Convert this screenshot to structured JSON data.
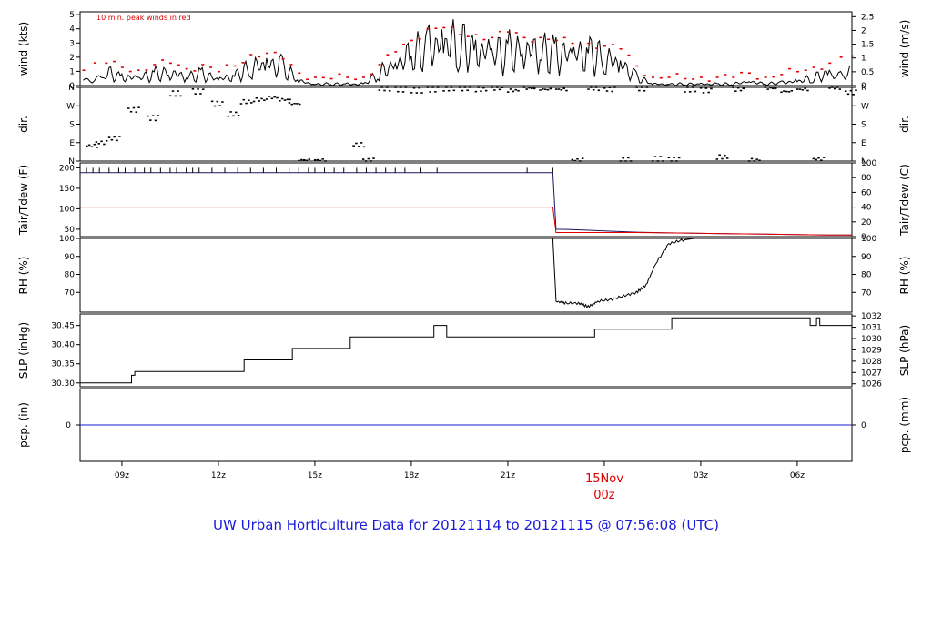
{
  "title": "UW Urban Horticulture Data for 20121114  to  20121115 @ 07:56:08  (UTC)",
  "colors": {
    "primary": "#000000",
    "peak": "#e00000",
    "dew": "#e00000",
    "precip": "#1a1adb",
    "title": "#1a1adb",
    "date": "#e00000"
  },
  "chart_data": [
    {
      "type": "line",
      "panel": "wind",
      "ylabel_left": "wind (kts)",
      "ylabel_right": "wind (m/s)",
      "annotation": "10 min. peak winds in red",
      "ylim": [
        0,
        5.2
      ],
      "yticks_left": [
        "0",
        "1",
        "2",
        "3",
        "4",
        "5"
      ],
      "yticks_right": [
        "0",
        "0.5",
        "1",
        "1.5",
        "2",
        "2.5"
      ],
      "x_hours": [
        7.8,
        8.5,
        9.0,
        9.5,
        10.0,
        10.5,
        11.0,
        11.5,
        12.0,
        12.5,
        13.0,
        13.5,
        14.0,
        14.5,
        15.0,
        15.5,
        16.0,
        16.5,
        17.0,
        17.5,
        18.0,
        18.5,
        19.0,
        19.5,
        20.0,
        20.5,
        21.0,
        21.5,
        22.0,
        22.5,
        23.0,
        23.5,
        24.0,
        24.5,
        25.0,
        25.5,
        26.0,
        26.5,
        27.0,
        27.5,
        28.0,
        28.5,
        29.0,
        29.5,
        30.0,
        30.5,
        31.0,
        31.7
      ],
      "series": [
        {
          "name": "",
          "values": [
            0.5,
            0.9,
            0.6,
            0.5,
            0.8,
            0.9,
            0.6,
            0.8,
            0.4,
            0.7,
            1.2,
            1.5,
            1.3,
            0.3,
            0.1,
            0.1,
            0.1,
            0.1,
            0.8,
            1.6,
            2.0,
            2.6,
            3.0,
            2.8,
            2.5,
            2.2,
            2.3,
            2.5,
            2.4,
            2.2,
            2.1,
            2.3,
            1.9,
            1.5,
            0.6,
            0.1,
            0.1,
            0.1,
            0.1,
            0.1,
            0.1,
            0.3,
            0.1,
            0.2,
            0.3,
            0.5,
            0.9,
            1.6
          ]
        },
        {
          "name": "10 min. peak winds",
          "values": [
            1.1,
            1.6,
            1.3,
            1.1,
            1.5,
            1.6,
            1.2,
            1.5,
            1.0,
            1.4,
            2.2,
            2.3,
            1.9,
            0.9,
            0.6,
            0.5,
            0.6,
            0.6,
            1.5,
            2.4,
            3.2,
            4.0,
            4.1,
            3.6,
            3.6,
            3.4,
            3.8,
            3.4,
            3.4,
            3.2,
            3.0,
            3.0,
            2.8,
            2.6,
            1.4,
            0.6,
            0.6,
            0.5,
            0.6,
            0.6,
            0.6,
            0.9,
            0.6,
            0.8,
            1.0,
            1.3,
            1.6,
            2.1
          ]
        }
      ]
    },
    {
      "type": "scatter",
      "panel": "direction",
      "ylabel_left": "dir.",
      "ylabel_right": "dir.",
      "ylim": [
        0,
        360
      ],
      "yticks": [
        "N",
        "E",
        "S",
        "W",
        "N"
      ],
      "x_hours": [
        7.9,
        8.2,
        8.6,
        9.2,
        9.8,
        10.5,
        11.2,
        11.8,
        12.3,
        12.7,
        13.1,
        13.5,
        13.9,
        14.2,
        14.5,
        15.0,
        16.2,
        16.5,
        17.0,
        17.5,
        18.0,
        18.5,
        19.0,
        19.5,
        20.0,
        20.5,
        21.0,
        21.5,
        22.0,
        22.5,
        23.0,
        23.5,
        24.0,
        24.5,
        25.0,
        25.5,
        26.0,
        26.5,
        27.0,
        27.5,
        28.0,
        28.5,
        29.0,
        29.5,
        30.0,
        30.5,
        31.0,
        31.5
      ],
      "values": [
        75,
        90,
        110,
        250,
        210,
        330,
        340,
        280,
        230,
        290,
        300,
        310,
        300,
        280,
        5,
        5,
        80,
        2,
        355,
        350,
        345,
        350,
        355,
        355,
        350,
        355,
        345,
        355,
        350,
        350,
        5,
        355,
        350,
        5,
        355,
        10,
        5,
        350,
        345,
        20,
        350,
        5,
        355,
        340,
        350,
        10,
        360,
        335
      ]
    },
    {
      "type": "line",
      "panel": "temperature",
      "ylabel_left": "Tair/Tdew (F)",
      "ylabel_right": "Tair/Tdew (C)",
      "ylim": [
        32,
        212
      ],
      "yticks_left": [
        "50",
        "100",
        "150",
        "200"
      ],
      "yticks_right": [
        "0",
        "20",
        "40",
        "60",
        "80",
        "100"
      ],
      "x_hours": [
        7.7,
        22.0,
        22.4,
        22.5,
        23.0,
        24.0,
        25.0,
        26.0,
        27.0,
        28.0,
        29.0,
        30.0,
        31.0,
        31.7
      ],
      "series": [
        {
          "name": "",
          "values": [
            188,
            188,
            188,
            50,
            49,
            46,
            43,
            41,
            40,
            39,
            38,
            37,
            36,
            36
          ]
        },
        {
          "name": "",
          "values": [
            104,
            104,
            104,
            42,
            42,
            42,
            42,
            41,
            40,
            39,
            38,
            37,
            36,
            36
          ]
        }
      ],
      "spike_hours": [
        7.9,
        8.1,
        8.3,
        8.6,
        8.9,
        9.1,
        9.4,
        9.7,
        9.9,
        10.2,
        10.5,
        10.7,
        11.0,
        11.2,
        11.4,
        11.8,
        12.2,
        12.6,
        13.0,
        13.4,
        13.8,
        14.2,
        14.5,
        14.8,
        15.0,
        15.3,
        15.6,
        15.9,
        16.3,
        16.6,
        16.9,
        17.2,
        17.5,
        17.8,
        18.3,
        18.8,
        21.6,
        22.4
      ],
      "spike_value": 200
    },
    {
      "type": "line",
      "panel": "rh",
      "ylabel_left": "RH (%)",
      "ylabel_right": "RH (%)",
      "ylim": [
        59,
        100
      ],
      "yticks": [
        "70",
        "80",
        "90",
        "100"
      ],
      "x_hours": [
        7.7,
        22.4,
        22.5,
        22.8,
        23.2,
        23.5,
        23.8,
        24.2,
        24.6,
        25.0,
        25.3,
        25.6,
        26.0,
        26.4,
        26.8,
        27.5,
        28.5,
        29.5,
        30.5,
        31.7
      ],
      "values": [
        100,
        100,
        65,
        64,
        64,
        62,
        65,
        66,
        68,
        70,
        74,
        86,
        97,
        99,
        100,
        100,
        100,
        100,
        100,
        100
      ]
    },
    {
      "type": "line",
      "panel": "pressure",
      "ylabel_left": "SLP (inHg)",
      "ylabel_right": "SLP (hPa)",
      "ylim": [
        30.29,
        30.48
      ],
      "yticks_left": [
        "30.30",
        "30.35",
        "30.40",
        "30.45"
      ],
      "yticks_right": [
        "1026",
        "1027",
        "1028",
        "1029",
        "1030",
        "1031",
        "1032"
      ],
      "x_hours": [
        7.7,
        9.3,
        9.3,
        9.4,
        9.4,
        12.8,
        12.8,
        14.3,
        14.3,
        16.1,
        16.1,
        18.7,
        18.7,
        19.1,
        19.1,
        23.7,
        23.7,
        26.1,
        26.1,
        30.4,
        30.4,
        30.6,
        30.6,
        30.7,
        30.7,
        31.7
      ],
      "values": [
        30.3,
        30.3,
        30.32,
        30.32,
        30.33,
        30.33,
        30.36,
        30.36,
        30.39,
        30.39,
        30.42,
        30.42,
        30.45,
        30.45,
        30.42,
        30.42,
        30.44,
        30.44,
        30.47,
        30.47,
        30.45,
        30.45,
        30.47,
        30.47,
        30.45,
        30.45
      ]
    },
    {
      "type": "line",
      "panel": "precip",
      "ylabel_left": "pcp. (in)",
      "ylabel_right": "pcp. (mm)",
      "yticks_left": [
        "0"
      ],
      "yticks_right": [
        "0"
      ],
      "x_hours": [
        7.7,
        31.7
      ],
      "values": [
        0,
        0
      ]
    }
  ],
  "x_axis": {
    "ticks": [
      {
        "hour": 9,
        "label": "09z"
      },
      {
        "hour": 12,
        "label": "12z"
      },
      {
        "hour": 15,
        "label": "15z"
      },
      {
        "hour": 18,
        "label": "18z"
      },
      {
        "hour": 21,
        "label": "21z"
      },
      {
        "hour": 24,
        "label": ""
      },
      {
        "hour": 27,
        "label": "03z"
      },
      {
        "hour": 30,
        "label": "06z"
      }
    ],
    "date_marker": {
      "hour": 24,
      "date": "15Nov",
      "time": "00z"
    }
  }
}
